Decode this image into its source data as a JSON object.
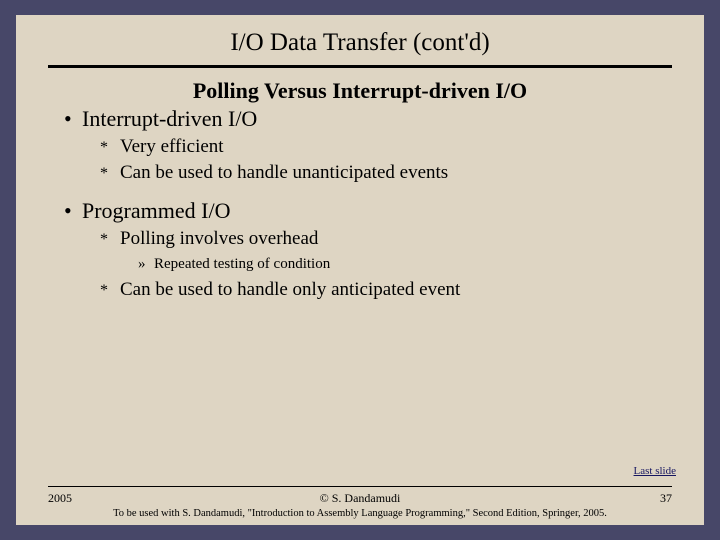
{
  "title": "I/O Data Transfer (cont'd)",
  "subtitle": "Polling Versus Interrupt-driven I/O",
  "b1": "Interrupt-driven I/O",
  "b1s1": "Very efficient",
  "b1s2": "Can be used to handle unanticipated events",
  "b2": "Programmed I/O",
  "b2s1": "Polling involves overhead",
  "b2s1a": "Repeated testing of condition",
  "b2s2": "Can be used to handle only anticipated event",
  "lastslide": "Last slide",
  "footer": {
    "year": "2005",
    "copyright": "© S. Dandamudi",
    "page": "37",
    "citation": "To be used with S. Dandamudi, \"Introduction to Assembly Language Programming,\" Second Edition, Springer, 2005."
  }
}
